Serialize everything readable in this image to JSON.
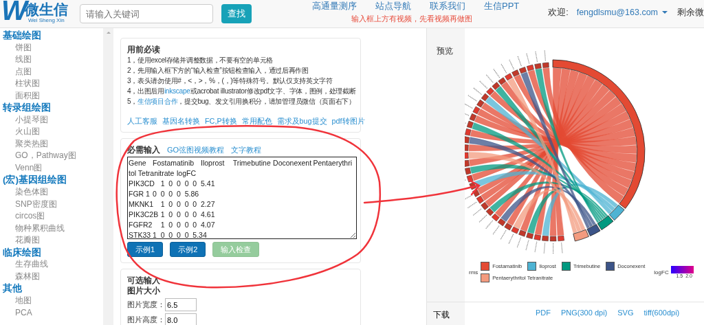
{
  "header": {
    "logo_letter": "W",
    "logo_title": "微生信",
    "logo_subtitle": "Wei Sheng Xin",
    "search": {
      "placeholder": "请输入关键词"
    },
    "search_button": "查找",
    "nav": [
      "高通量测序",
      "站点导航",
      "联系我们",
      "生信PPT"
    ],
    "notice": "输入框上方有视频，先看视频再做图",
    "welcome": "欢迎:",
    "user": "fengdlsmu@163.com",
    "balance": "剩余微"
  },
  "sidebar": {
    "groups": [
      {
        "title": "基础绘图",
        "items": [
          "饼图",
          "线图",
          "点图",
          "柱状图",
          "面积图"
        ]
      },
      {
        "title": "转录组绘图",
        "items": [
          "小提琴图",
          "火山图",
          "聚类热图",
          "GO，Pathway图",
          "Venn图"
        ]
      },
      {
        "title": "(宏)基因组绘图",
        "items": [
          "染色体图",
          "SNP密度图",
          "circos图",
          "物种累积曲线",
          "花瓣图"
        ]
      },
      {
        "title": "临床绘图",
        "items": [
          "生存曲线",
          "森林图"
        ]
      },
      {
        "title": "其他",
        "items": [
          "地图",
          "PCA"
        ]
      }
    ]
  },
  "guide": {
    "title": "用前必读",
    "lines": [
      [
        {
          "text": "1，使用excel存储并调整数据，不要有空的单元格",
          "kind": "plain"
        }
      ],
      [
        {
          "text": "2，先用输入框下方的“输入检查”按钮检查输入，通过后再作图",
          "kind": "plain"
        }
      ],
      [
        {
          "text": "3，表头请勿使用#，<，>，%，(，)等特殊符号。默认仅支持英文字符",
          "kind": "plain"
        }
      ],
      [
        {
          "text": "4，出图后用",
          "kind": "plain"
        },
        {
          "text": "inkscape",
          "kind": "link"
        },
        {
          "text": "或acrobat illustrator修改pdf文字、字体，图例，处理截断",
          "kind": "plain"
        }
      ],
      [
        {
          "text": "5，",
          "kind": "plain"
        },
        {
          "text": "生信项目合作",
          "kind": "link"
        },
        {
          "text": "，提交bug、发文引用换积分，请加管理员微信（页面右下）",
          "kind": "plain"
        }
      ]
    ],
    "links": [
      "人工客服",
      "基因名转换",
      "FC,P转换",
      "常用配色",
      "需求及bug提交",
      "pdf转图片"
    ]
  },
  "input": {
    "title": "必需输入",
    "links": [
      "GO弦图视频教程",
      "文字教程"
    ],
    "lines": [
      "Gene\tFostamatinib\tIloprost\tTrimebutine\tDoconexent\tPentaerythri",
      "tol Tetranitrate\tlogFC",
      "PIK3CD\t1\t0\t0\t0\t0\t5.41",
      "FGR 1\t0\t0\t0\t0\t5.86",
      "MKNK1\t1\t0\t0\t0\t0\t2.27",
      "PIK3C2B\t1\t0\t0\t0\t0\t4.61",
      "FGFR2\t1\t0\t0\t0\t0\t4.07",
      "STK33\t1\t0\t0\t0\t0\t5.34"
    ],
    "buttons": [
      {
        "label": "示例1",
        "kind": "primary",
        "disabled": false
      },
      {
        "label": "示例2",
        "kind": "primary",
        "disabled": false
      },
      {
        "label": "输入检查",
        "kind": "success",
        "disabled": true
      }
    ]
  },
  "options": {
    "title": "可选输入",
    "subtitle": "图片大小",
    "fields": [
      {
        "label": "图片宽度：",
        "value": "6.5"
      },
      {
        "label": "图片高度：",
        "value": "8.0"
      }
    ]
  },
  "preview": {
    "label": "预览",
    "legend": {
      "title": "rms",
      "items": [
        {
          "name": "Fostamatinib",
          "color": "#e34a33"
        },
        {
          "name": "Iloprost",
          "color": "#4eb3d3"
        },
        {
          "name": "Trimebutine",
          "color": "#009980"
        },
        {
          "name": "Doconexent",
          "color": "#3c5488"
        },
        {
          "name": "Pentaerythritol Tetranitrate",
          "color": "#f39b7f"
        }
      ],
      "scale": {
        "title": "logFC",
        "ticks": [
          "1.5",
          "2.0"
        ]
      }
    }
  },
  "download": {
    "label": "下载",
    "links": [
      "PDF",
      "PNG(300 dpi)",
      "SVG",
      "tiff(600dpi)"
    ]
  }
}
